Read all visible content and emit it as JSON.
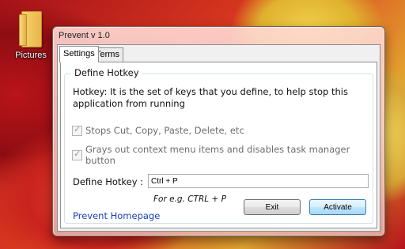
{
  "desktop": {
    "icon_label": "Pictures"
  },
  "window": {
    "title": "Prevent v 1.0"
  },
  "tabs": [
    {
      "label": "Settings"
    },
    {
      "label": "Terms"
    }
  ],
  "group": {
    "title": "Define Hotkey",
    "description": "Hotkey: It is the set of keys that you define, to help stop this application from running"
  },
  "options": [
    {
      "label": "Stops Cut, Copy, Paste, Delete, etc",
      "checked": true,
      "disabled": true
    },
    {
      "label": "Grays out context menu items and disables task manager button",
      "checked": true,
      "disabled": true
    }
  ],
  "hotkey": {
    "label": "Define Hotkey :",
    "value": "Ctrl + P",
    "hint": "For e.g. CTRL + P"
  },
  "link": {
    "label": "Prevent Homepage"
  },
  "buttons": {
    "exit": "Exit",
    "activate": "Activate"
  }
}
